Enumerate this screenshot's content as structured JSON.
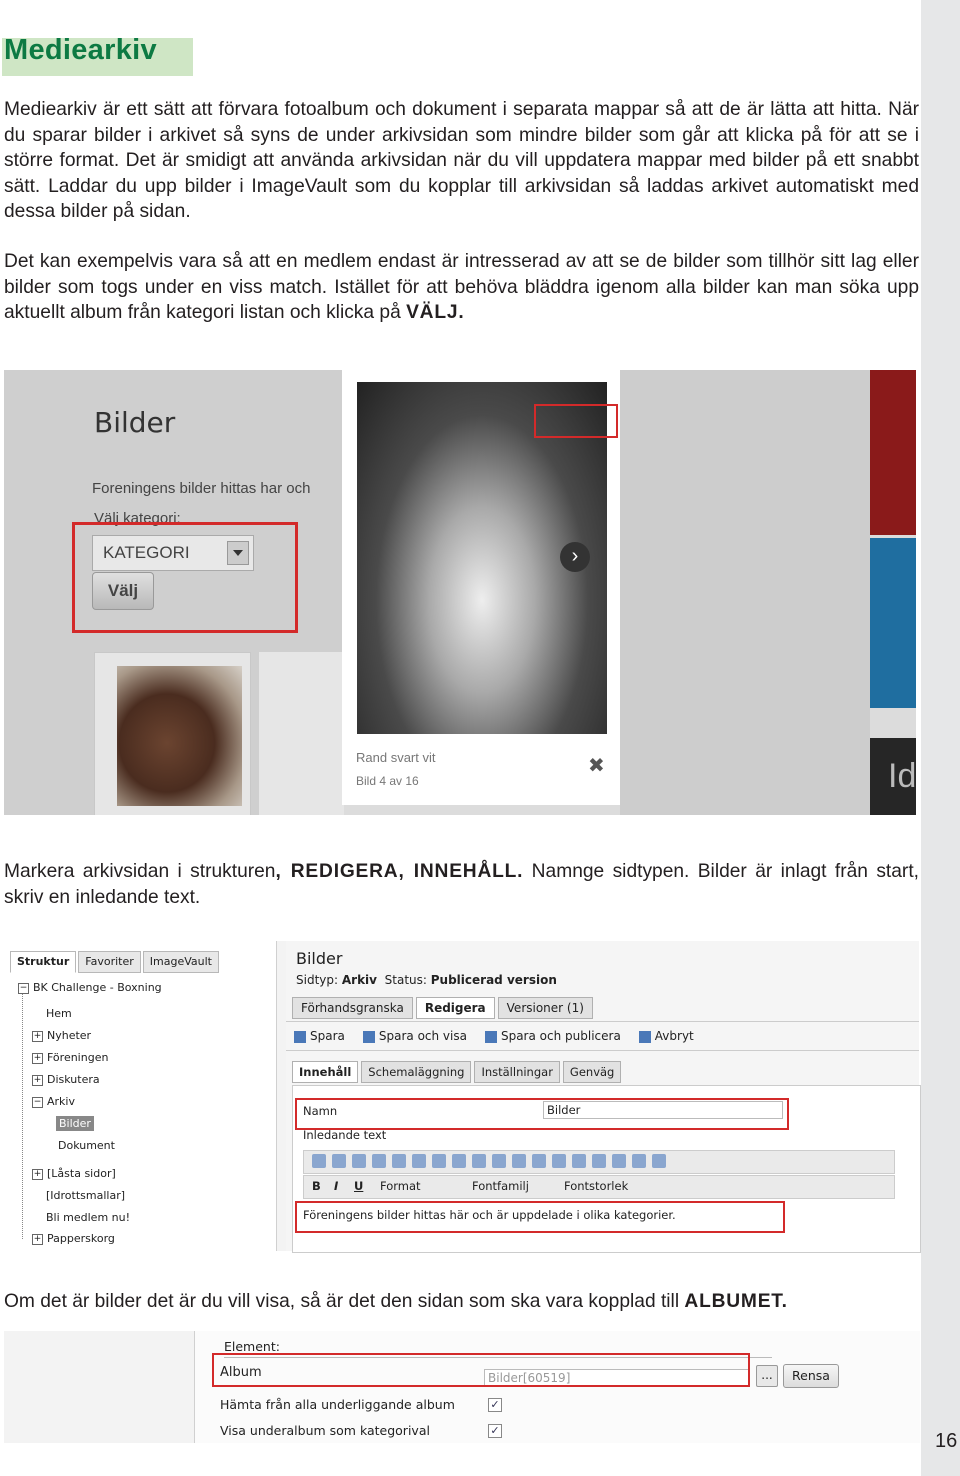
{
  "heading": "Mediearkiv",
  "paragraphs": {
    "p1": "Mediearkiv är ett sätt att förvara fotoalbum och dokument i separata mappar så att de är lätta att hitta. När du sparar bilder i arkivet så syns de under arkivsidan som mindre bilder som går att klicka på för att se i större format. Det är smidigt att använda arkivsidan när du vill uppdatera mappar med bilder på ett snabbt sätt. Laddar du upp bilder i ImageVault som du kopplar till arkivsidan så laddas arkivet automatiskt med dessa bilder på sidan.",
    "p2_text": "Det kan exempelvis vara så att en medlem endast är intresserad av att se de bilder som tillhör sitt lag eller bilder som togs under en viss match. Istället för att behöva bläddra igenom alla bilder kan man söka upp aktuellt album från kategori listan och klicka på ",
    "p2_bold": "VÄLJ.",
    "p3_a": "Markera arkivsidan i strukturen",
    "p3_bold": ", REDIGERA, INNEHÅLL.",
    "p3_b": " Namnge sidtypen. Bilder är inlagt från start, skriv en inledande text.",
    "p4_text": "Om det är bilder det är du vill visa, så är det den sidan som ska vara kopplad till ",
    "p4_bold": "ALBUMET."
  },
  "screenshot1": {
    "title": "Bilder",
    "description": "Foreningens bilder hittas har och",
    "label": "Välj kategori:",
    "select_value": "KATEGORI",
    "button": "Välj",
    "caption1": "Rand svart vit",
    "caption2": "Bild 4 av 16",
    "right_text": "Id"
  },
  "screenshot2": {
    "tree_tabs": [
      "Struktur",
      "Favoriter",
      "ImageVault"
    ],
    "tree_items": [
      "BK Challenge - Boxning",
      "Hem",
      "Nyheter",
      "Föreningen",
      "Diskutera",
      "Arkiv",
      "Bilder",
      "Dokument",
      "[Låsta sidor]",
      "[Idrottsmallar]",
      "Bli medlem nu!",
      "Papperskorg"
    ],
    "page_title": "Bilder",
    "sidtyp_label": "Sidtyp:",
    "sidtyp_value": "Arkiv",
    "status_label": "Status:",
    "status_value": "Publicerad version",
    "edit_tabs": [
      "Förhandsgranska",
      "Redigera",
      "Versioner (1)"
    ],
    "actions": [
      "Spara",
      "Spara och visa",
      "Spara och publicera",
      "Avbryt"
    ],
    "sub_tabs": [
      "Innehåll",
      "Schemaläggning",
      "Inställningar",
      "Genväg"
    ],
    "name_label": "Namn",
    "name_value": "Bilder",
    "intro_label": "Inledande text",
    "rte_format": "Format",
    "rte_font": "Fontfamilj",
    "rte_size": "Fontstorlek",
    "intro_value": "Föreningens bilder hittas här och är uppdelade i olika kategorier."
  },
  "screenshot3": {
    "element_label": "Element:",
    "album_label": "Album",
    "album_value": "Bilder[60519]",
    "browse_button": "...",
    "clear_button": "Rensa",
    "option1": "Hämta från alla underliggande album",
    "option2": "Visa underalbum som kategorival"
  },
  "page_number": "16"
}
